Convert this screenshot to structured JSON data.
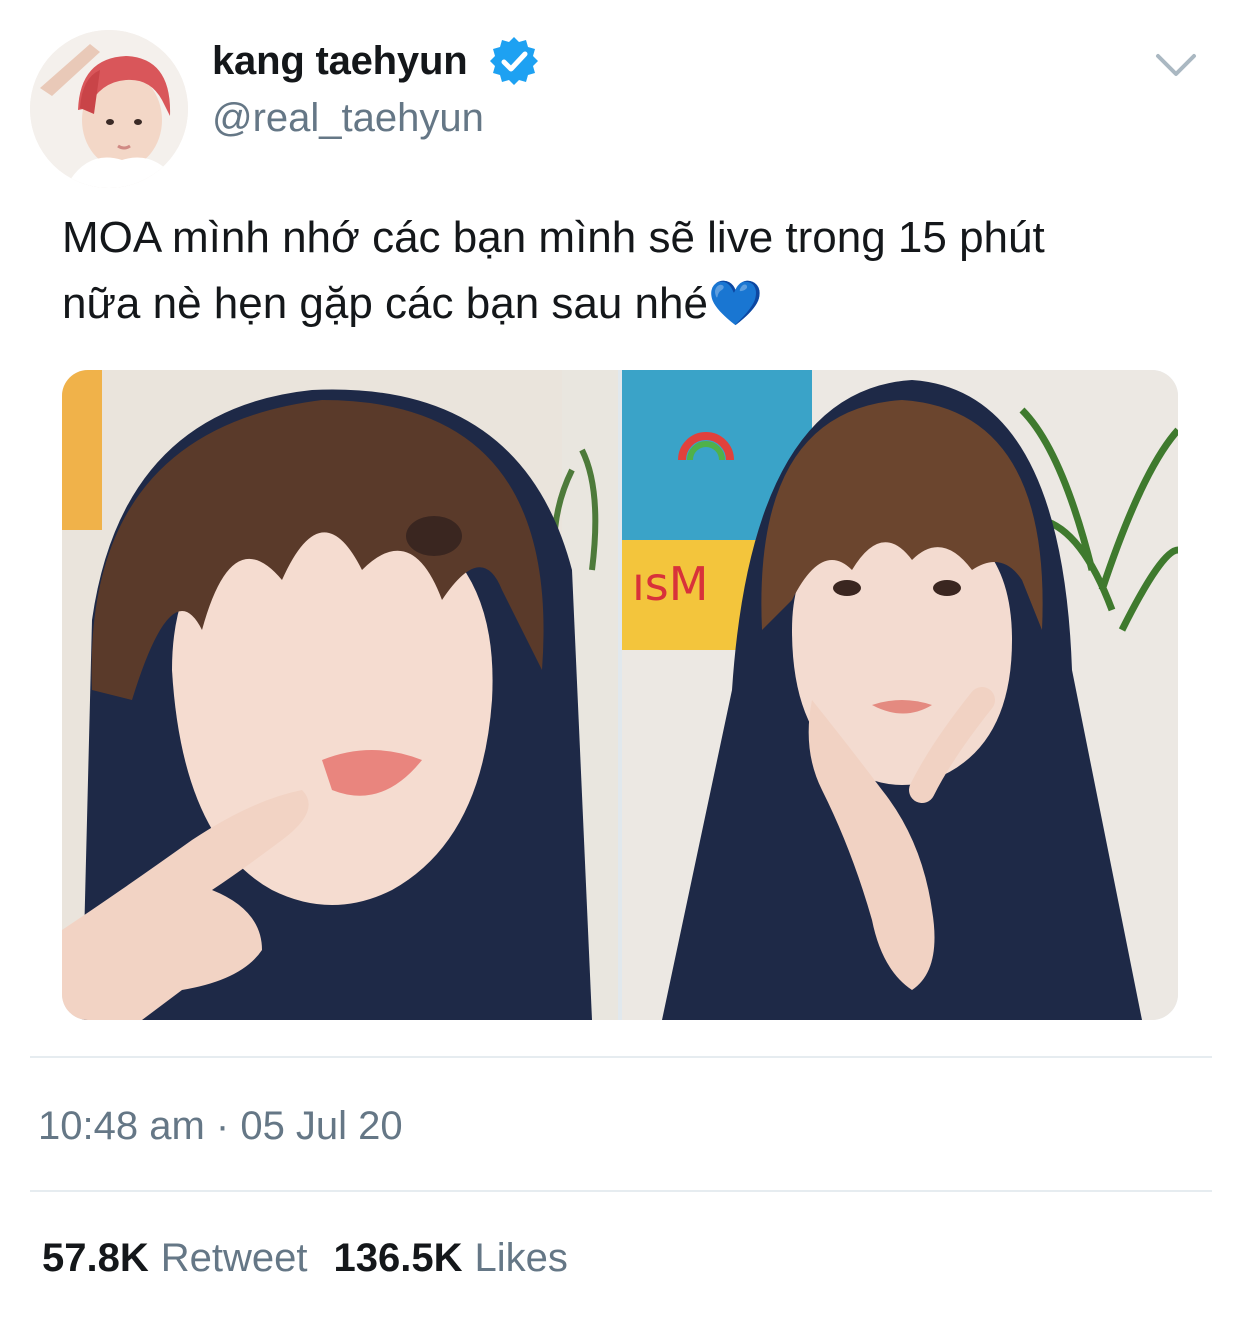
{
  "tweet": {
    "author": {
      "display_name": "kang taehyun",
      "handle": "@real_taehyun",
      "verified": true,
      "verified_icon": "verified-badge-icon",
      "verified_color": "#1da1f2"
    },
    "text_line1": "MOA mình nhớ các bạn mình sẽ live trong 15 phút",
    "text_line2": "nữa nè hẹn gặp các bạn sau nhé💙",
    "media": [
      {
        "alt": "photo 1"
      },
      {
        "alt": "photo 2"
      }
    ],
    "timestamp": "10:48 am · 05 Jul 20",
    "stats": {
      "retweets_count": "57.8K",
      "retweets_label": "Retweet",
      "likes_count": "136.5K",
      "likes_label": "Likes"
    },
    "menu_icon": "chevron-down-icon"
  },
  "colors": {
    "text_primary": "#14171a",
    "text_secondary": "#657786",
    "divider": "#e6ecf0",
    "accent": "#1da1f2"
  }
}
